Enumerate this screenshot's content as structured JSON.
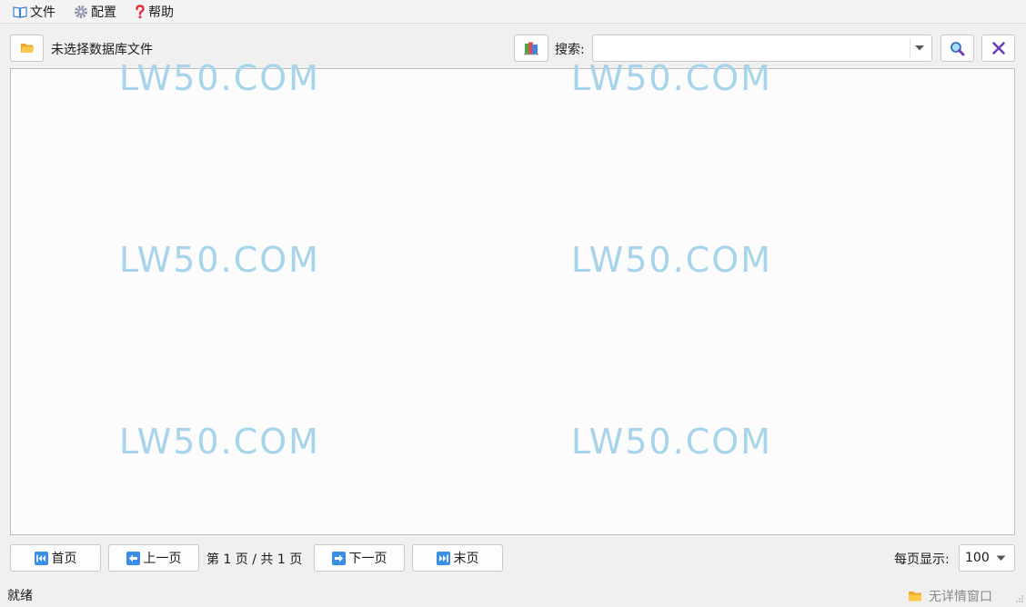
{
  "menu": {
    "file_label": "文件",
    "config_label": "配置",
    "help_label": "帮助"
  },
  "toolbar": {
    "db_status": "未选择数据库文件",
    "search_label": "搜索:",
    "search_value": "",
    "open_icon": "folder-open-icon",
    "layout_icon": "color-books-icon",
    "search_icon": "magnifier-icon",
    "clear_icon": "close-x-icon"
  },
  "watermark": {
    "text": "LW50.COM",
    "color": "#a6d4ea"
  },
  "pagination": {
    "first_label": "首页",
    "prev_label": "上一页",
    "page_info": "第 1 页 / 共 1 页",
    "next_label": "下一页",
    "last_label": "末页",
    "per_page_label": "每页显示:",
    "per_page_value": "100"
  },
  "status": {
    "text": "就绪",
    "detail_window": "无详情窗口"
  },
  "colors": {
    "accent_blue": "#3a8ee6",
    "folder_yellow": "#f5b93a",
    "close_purple": "#6a3fb5"
  }
}
